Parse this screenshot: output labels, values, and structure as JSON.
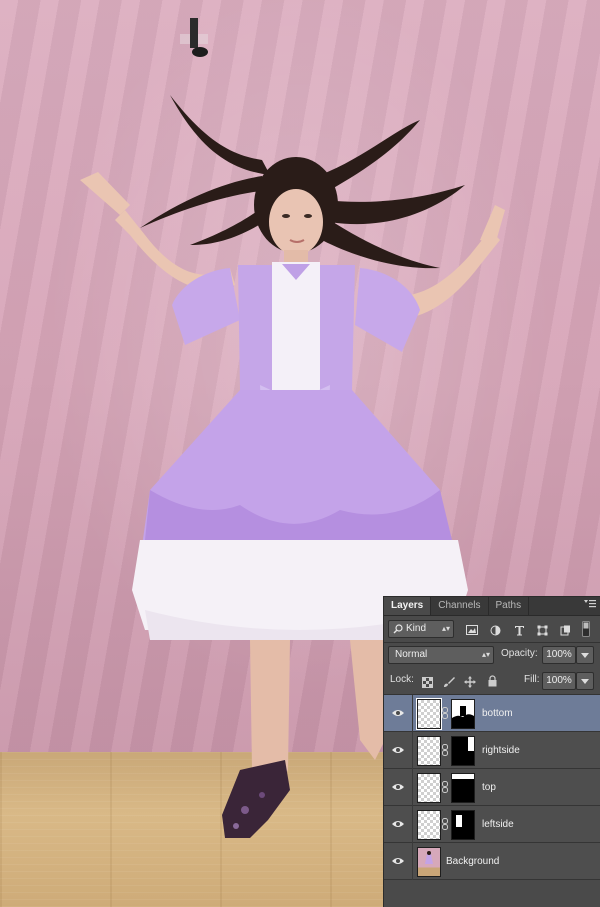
{
  "panel": {
    "tabs": [
      {
        "label": "Layers",
        "active": true
      },
      {
        "label": "Channels",
        "active": false
      },
      {
        "label": "Paths",
        "active": false
      }
    ],
    "menu_icon": "panel-menu-icon",
    "filter": {
      "kind_label": "Kind"
    },
    "blend_mode": "Normal",
    "opacity_label": "Opacity:",
    "opacity_value": "100%",
    "lock_label": "Lock:",
    "fill_label": "Fill:",
    "fill_value": "100%",
    "layers": [
      {
        "name": "bottom",
        "selected": true,
        "has_mask": true
      },
      {
        "name": "rightside",
        "selected": false,
        "has_mask": true
      },
      {
        "name": "top",
        "selected": false,
        "has_mask": true
      },
      {
        "name": "leftside",
        "selected": false,
        "has_mask": true
      },
      {
        "name": "Background",
        "selected": false,
        "has_mask": false
      }
    ]
  },
  "colors": {
    "panel_bg": "#4a4a4a",
    "selected_layer": "#6e7c98",
    "backdrop_pink": "#d9a9bb",
    "dress_lavender": "#c3a3e6"
  }
}
